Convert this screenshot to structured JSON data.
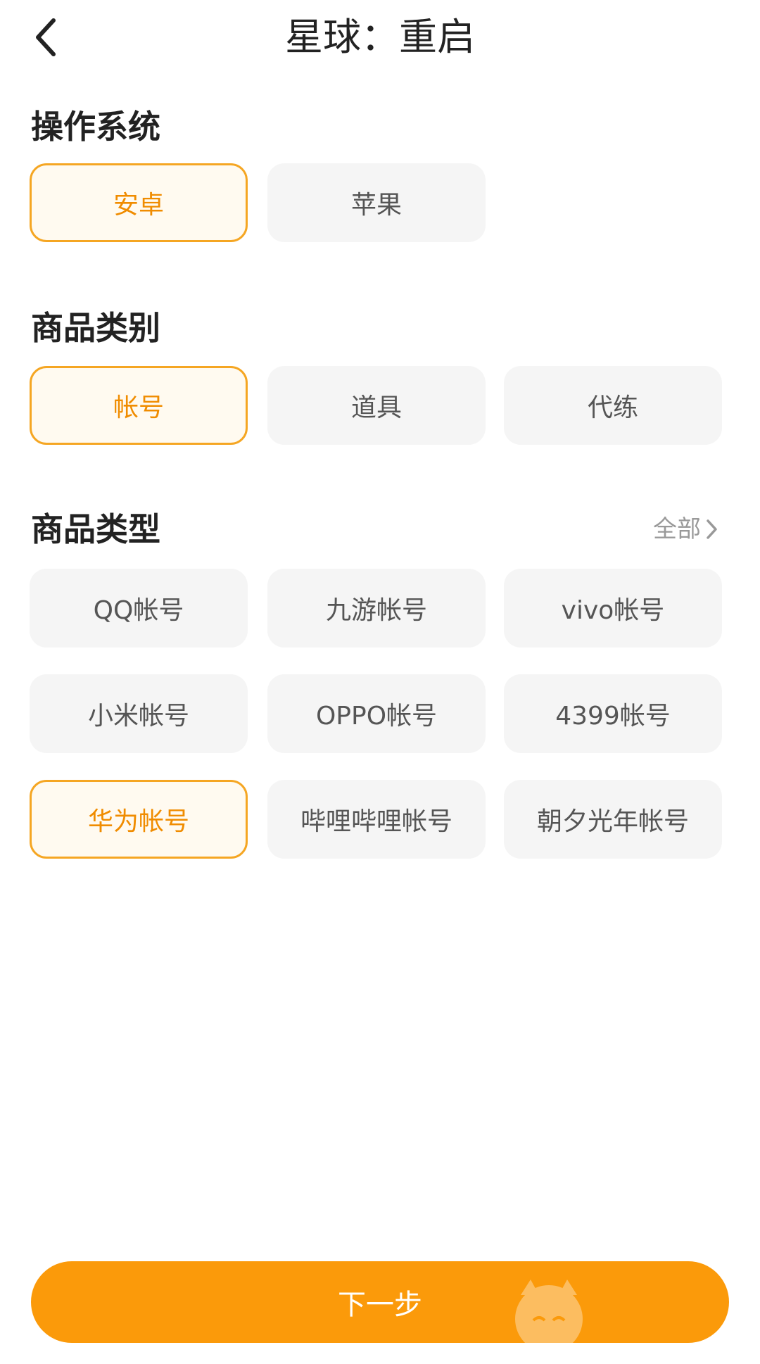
{
  "header": {
    "title": "星球：重启",
    "back_icon": "chevron-left-icon"
  },
  "os_section": {
    "title": "操作系统",
    "options": [
      {
        "label": "安卓",
        "selected": true
      },
      {
        "label": "苹果",
        "selected": false
      }
    ]
  },
  "category_section": {
    "title": "商品类别",
    "options": [
      {
        "label": "帐号",
        "selected": true
      },
      {
        "label": "道具",
        "selected": false
      },
      {
        "label": "代练",
        "selected": false
      }
    ]
  },
  "type_section": {
    "title": "商品类型",
    "all_label": "全部",
    "options": [
      {
        "label": "QQ帐号",
        "selected": false
      },
      {
        "label": "九游帐号",
        "selected": false
      },
      {
        "label": "vivo帐号",
        "selected": false
      },
      {
        "label": "小米帐号",
        "selected": false
      },
      {
        "label": "OPPO帐号",
        "selected": false
      },
      {
        "label": "4399帐号",
        "selected": false
      },
      {
        "label": "华为帐号",
        "selected": true
      },
      {
        "label": "哔哩哔哩帐号",
        "selected": false
      },
      {
        "label": "朝夕光年帐号",
        "selected": false
      }
    ]
  },
  "footer": {
    "next_label": "下一步"
  },
  "colors": {
    "accent": "#fb9a0a",
    "selected_border": "#f5a623",
    "selected_text": "#f08c00",
    "chip_bg": "#f5f5f5"
  }
}
